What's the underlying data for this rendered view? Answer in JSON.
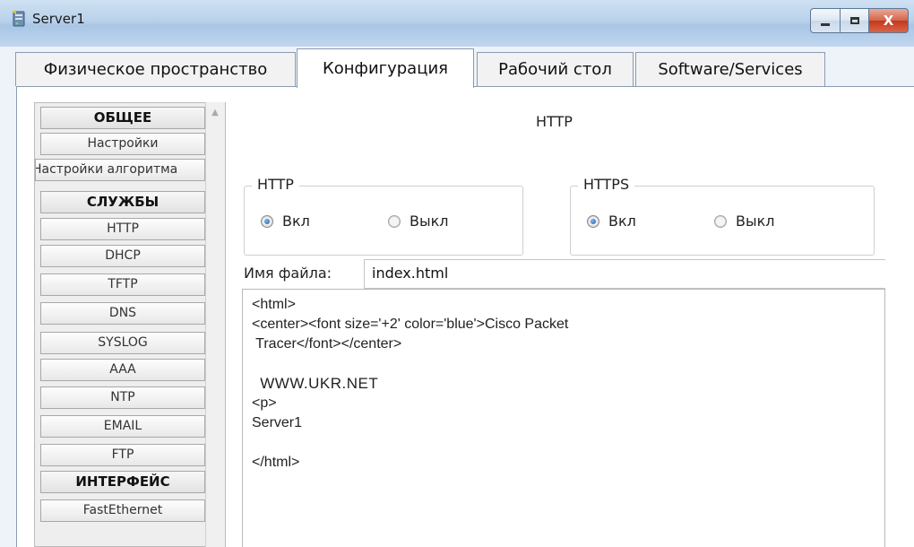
{
  "window": {
    "title": "Server1",
    "minimize_label": "",
    "maximize_label": "",
    "close_label": "X"
  },
  "tabs": [
    {
      "label": "Физическое пространство",
      "active": false
    },
    {
      "label": "Конфигурация",
      "active": true
    },
    {
      "label": "Рабочий стол",
      "active": false
    },
    {
      "label": "Software/Services",
      "active": false
    }
  ],
  "sidebar": {
    "items": [
      {
        "label": "ОБЩЕЕ",
        "type": "header"
      },
      {
        "label": "Настройки",
        "type": "item"
      },
      {
        "label": "Настройки алгоритма",
        "type": "item"
      },
      {
        "label": "СЛУЖБЫ",
        "type": "header"
      },
      {
        "label": "HTTP",
        "type": "item"
      },
      {
        "label": "DHCP",
        "type": "item"
      },
      {
        "label": "TFTP",
        "type": "item"
      },
      {
        "label": "DNS",
        "type": "item"
      },
      {
        "label": "SYSLOG",
        "type": "item"
      },
      {
        "label": "AAA",
        "type": "item"
      },
      {
        "label": "NTP",
        "type": "item"
      },
      {
        "label": "EMAIL",
        "type": "item"
      },
      {
        "label": "FTP",
        "type": "item"
      },
      {
        "label": "ИНТЕРФЕЙС",
        "type": "header"
      },
      {
        "label": "FastEthernet",
        "type": "item"
      }
    ]
  },
  "main": {
    "section_title": "HTTP",
    "http": {
      "legend": "HTTP",
      "on_label": "Вкл",
      "off_label": "Выкл",
      "selected": "on"
    },
    "https": {
      "legend": "HTTPS",
      "on_label": "Вкл",
      "off_label": "Выкл",
      "selected": "on"
    },
    "filename_label": "Имя файла:",
    "filename_value": "index.html",
    "editor_lines": [
      "<html>",
      "<center><font size='+2' color='blue'>Cisco Packet",
      " Tracer</font></center>",
      "",
      " WWW.UKR.NET",
      "<p>",
      "Server1",
      "",
      "</html>"
    ]
  },
  "colors": {
    "titlebar": "#b9d1ea",
    "close_button": "#c4391a",
    "radio_selected": "#1b5fb0",
    "sidebar_bg": "#eeeeee"
  },
  "icons": {
    "app": "packet-tracer-server-icon",
    "minimize": "minimize-icon",
    "maximize": "maximize-icon",
    "close": "close-icon"
  }
}
